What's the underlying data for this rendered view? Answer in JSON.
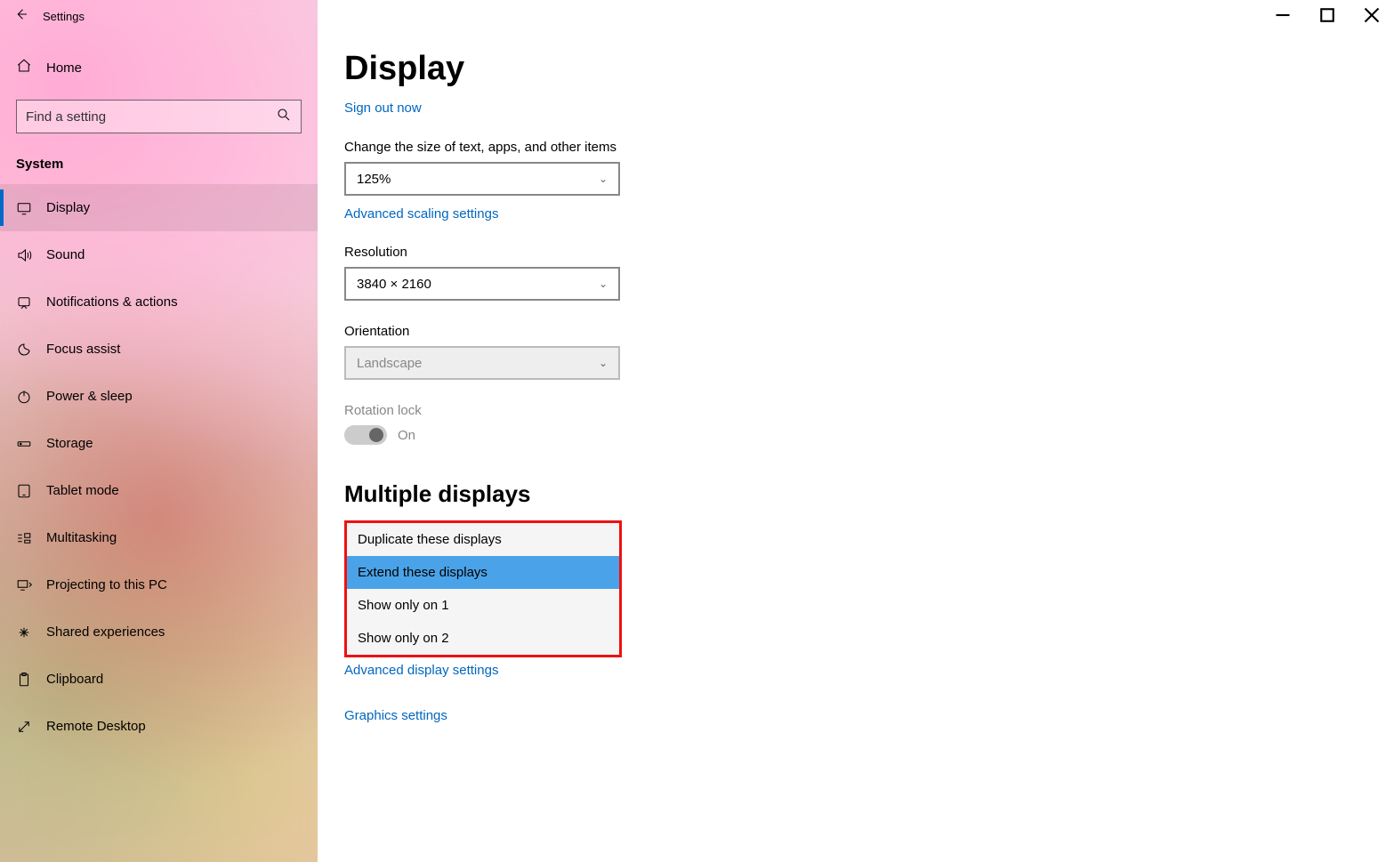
{
  "window": {
    "title": "Settings"
  },
  "sidebar": {
    "home": "Home",
    "search_placeholder": "Find a setting",
    "section": "System",
    "items": [
      {
        "label": "Display",
        "icon": "display-icon",
        "active": true
      },
      {
        "label": "Sound",
        "icon": "sound-icon"
      },
      {
        "label": "Notifications & actions",
        "icon": "notifications-icon"
      },
      {
        "label": "Focus assist",
        "icon": "focus-assist-icon"
      },
      {
        "label": "Power & sleep",
        "icon": "power-icon"
      },
      {
        "label": "Storage",
        "icon": "storage-icon"
      },
      {
        "label": "Tablet mode",
        "icon": "tablet-icon"
      },
      {
        "label": "Multitasking",
        "icon": "multitasking-icon"
      },
      {
        "label": "Projecting to this PC",
        "icon": "projecting-icon"
      },
      {
        "label": "Shared experiences",
        "icon": "shared-icon"
      },
      {
        "label": "Clipboard",
        "icon": "clipboard-icon"
      },
      {
        "label": "Remote Desktop",
        "icon": "remote-icon"
      }
    ]
  },
  "page": {
    "title": "Display",
    "sign_out": "Sign out now",
    "scale_label": "Change the size of text, apps, and other items",
    "scale_value": "125%",
    "adv_scaling": "Advanced scaling settings",
    "resolution_label": "Resolution",
    "resolution_value": "3840 × 2160",
    "orientation_label": "Orientation",
    "orientation_value": "Landscape",
    "rotation_label": "Rotation lock",
    "rotation_state": "On",
    "multi_head": "Multiple displays",
    "multi_options": [
      "Duplicate these displays",
      "Extend these displays",
      "Show only on 1",
      "Show only on 2"
    ],
    "multi_selected_index": 1,
    "adv_display": "Advanced display settings",
    "graphics": "Graphics settings"
  }
}
